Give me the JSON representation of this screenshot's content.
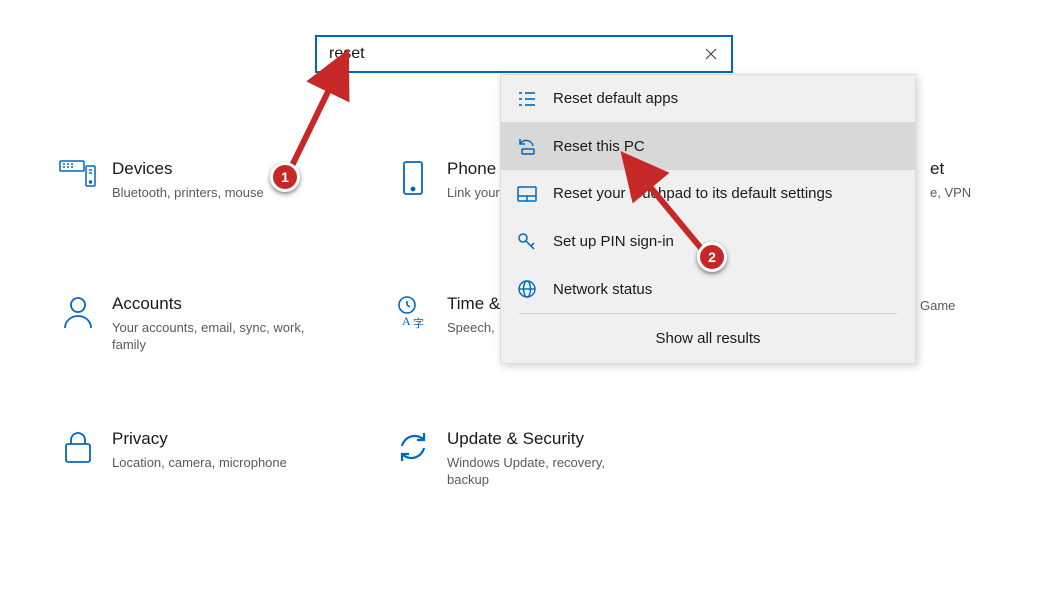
{
  "search": {
    "value": "reset",
    "clear_icon": "close-icon"
  },
  "suggestions": {
    "items": [
      {
        "icon": "reset-default-icon",
        "label": "Reset default apps"
      },
      {
        "icon": "reset-pc-icon",
        "label": "Reset this PC"
      },
      {
        "icon": "touchpad-icon",
        "label": "Reset your touchpad to its default settings"
      },
      {
        "icon": "key-icon",
        "label": "Set up PIN sign-in"
      },
      {
        "icon": "globe-icon",
        "label": "Network status"
      }
    ],
    "selected_index": 1,
    "show_all_label": "Show all results"
  },
  "tiles": {
    "devices": {
      "title": "Devices",
      "sub": "Bluetooth, printers, mouse"
    },
    "accounts": {
      "title": "Accounts",
      "sub": "Your accounts, email, sync, work, family"
    },
    "privacy": {
      "title": "Privacy",
      "sub": "Location, camera, microphone"
    },
    "phone": {
      "title": "Phone",
      "sub": "Link your"
    },
    "time": {
      "title": "Time &",
      "sub": "Speech,"
    },
    "update": {
      "title": "Update & Security",
      "sub": "Windows Update, recovery, backup"
    },
    "network": {
      "title_suffix": "et",
      "sub_suffix": "e, VPN"
    },
    "gaming": {
      "title_suffix": "Game"
    }
  },
  "annotations": {
    "badge1": "1",
    "badge2": "2"
  },
  "colors": {
    "accent": "#0067c0",
    "badge": "#c62828"
  }
}
